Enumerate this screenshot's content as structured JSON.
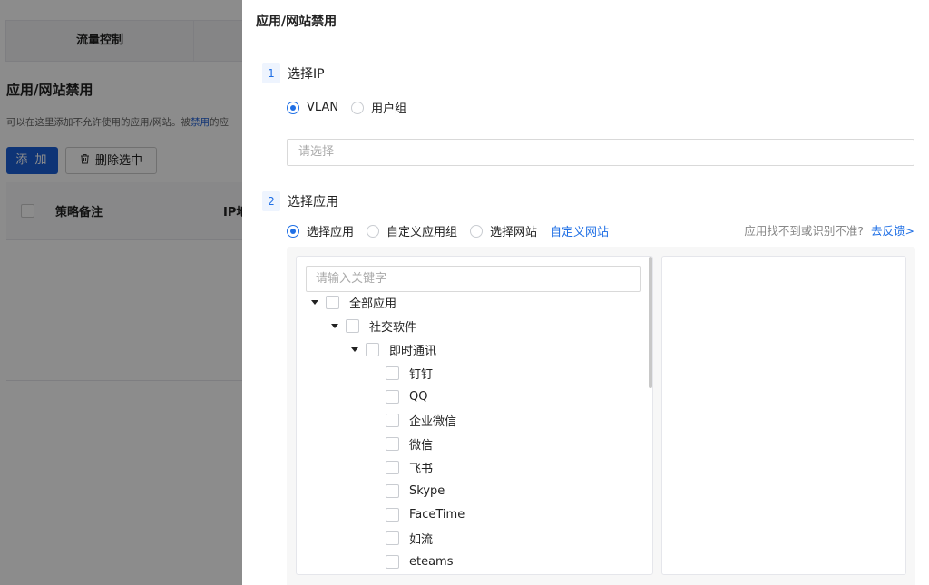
{
  "background": {
    "tabs": [
      "流量控制",
      ""
    ],
    "title": "应用/网站禁用",
    "desc_prefix": "可以在这里添加不允许使用的应用/网站。被",
    "desc_link": "禁用",
    "desc_suffix": "的应",
    "add_button": "添 加",
    "delete_button": "删除选中",
    "table_headers": [
      "策略备注",
      "IP地"
    ]
  },
  "drawer": {
    "title": "应用/网站禁用",
    "step1": {
      "num": "1",
      "label": "选择IP"
    },
    "ip_options": [
      "VLAN",
      "用户组"
    ],
    "ip_selected": "VLAN",
    "select_placeholder": "请选择",
    "step2": {
      "num": "2",
      "label": "选择应用"
    },
    "app_options": [
      "选择应用",
      "自定义应用组",
      "选择网站"
    ],
    "app_selected": "选择应用",
    "custom_site_link": "自定义网站",
    "feedback_text": "应用找不到或识别不准?",
    "feedback_link": "去反馈>",
    "search_placeholder": "请输入关键字",
    "tree": {
      "root": "全部应用",
      "category": "社交软件",
      "subcategory": "即时通讯",
      "items": [
        "钉钉",
        "QQ",
        "企业微信",
        "微信",
        "飞书",
        "Skype",
        "FaceTime",
        "如流",
        "eteams"
      ]
    }
  }
}
